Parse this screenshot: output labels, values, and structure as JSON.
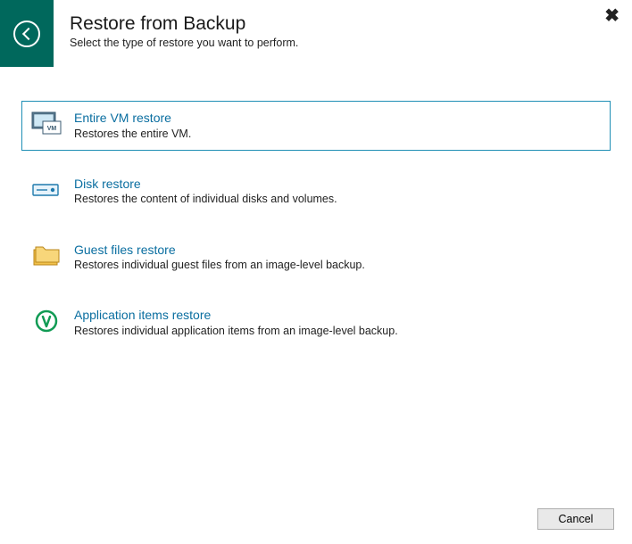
{
  "header": {
    "title": "Restore from Backup",
    "subtitle": "Select the type of restore you want to perform."
  },
  "options": [
    {
      "id": "entire-vm",
      "title": "Entire VM restore",
      "desc": "Restores the entire VM.",
      "selected": true
    },
    {
      "id": "disk",
      "title": "Disk restore",
      "desc": "Restores the content of individual disks and volumes.",
      "selected": false
    },
    {
      "id": "guest-files",
      "title": "Guest files restore",
      "desc": "Restores individual guest files from an image-level backup.",
      "selected": false
    },
    {
      "id": "app-items",
      "title": "Application items restore",
      "desc": "Restores individual application items from an image-level backup.",
      "selected": false
    }
  ],
  "footer": {
    "cancel": "Cancel"
  }
}
